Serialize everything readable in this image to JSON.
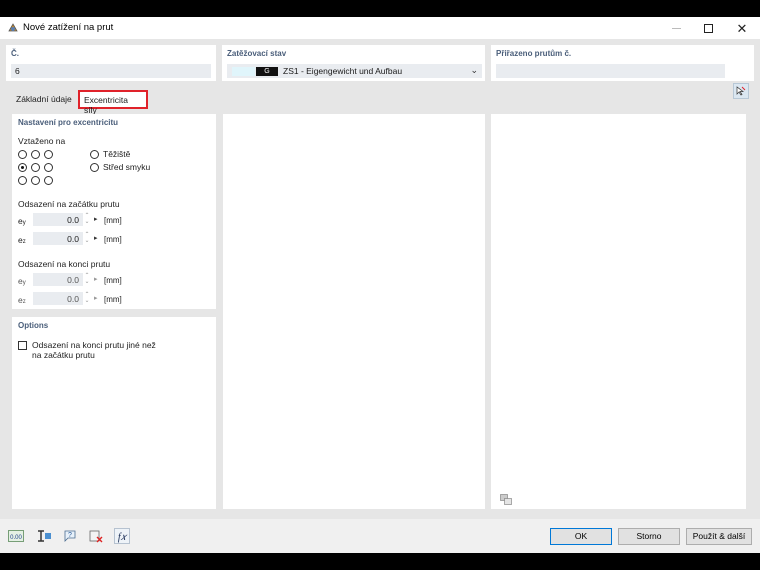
{
  "window": {
    "title": "Nové zatížení na prut"
  },
  "fields": {
    "number": {
      "label": "Č.",
      "value": "6"
    },
    "load_case": {
      "label": "Zatěžovací stav",
      "code": "G",
      "value": "ZS1 - Eigengewicht und Aufbau"
    },
    "assigned": {
      "label": "Přiřazeno prutům č.",
      "value": ""
    }
  },
  "tabs": [
    {
      "label": "Základní údaje",
      "active": false
    },
    {
      "label": "Excentricita síly",
      "active": true
    }
  ],
  "eccentricity": {
    "title": "Nastavení pro excentricitu",
    "related_to_label": "Vztaženo na",
    "grid_selected": {
      "row": 2,
      "col": 1
    },
    "options": [
      {
        "label": "Těžiště",
        "checked": false
      },
      {
        "label": "Střed smyku",
        "checked": false
      }
    ],
    "start": {
      "title": "Odsazení na začátku prutu",
      "ey": {
        "symbol": "e",
        "sub": "y",
        "value": "0.0",
        "unit": "[mm]"
      },
      "ez": {
        "symbol": "e",
        "sub": "z",
        "value": "0.0",
        "unit": "[mm]"
      }
    },
    "end": {
      "title": "Odsazení na konci prutu",
      "ey": {
        "symbol": "e",
        "sub": "y",
        "value": "0.0",
        "unit": "[mm]"
      },
      "ez": {
        "symbol": "e",
        "sub": "z",
        "value": "0.0",
        "unit": "[mm]"
      }
    }
  },
  "options_section": {
    "title": "Options",
    "checkbox_label_line1": "Odsazení na konci prutu jiné než",
    "checkbox_label_line2": "na začátku prutu",
    "checked": false
  },
  "toolbar": {
    "icons": [
      "units-icon",
      "section-icon",
      "help-icon",
      "delete-icon",
      "formula-icon"
    ],
    "units_text": "0.00",
    "formula_text": "f𝑥"
  },
  "buttons": {
    "ok": "OK",
    "cancel": "Storno",
    "apply_next": "Použít & další"
  },
  "colors": {
    "accent": "#4a5e7a",
    "highlight": "#e0222a",
    "field_bg": "#e9ecf0"
  }
}
